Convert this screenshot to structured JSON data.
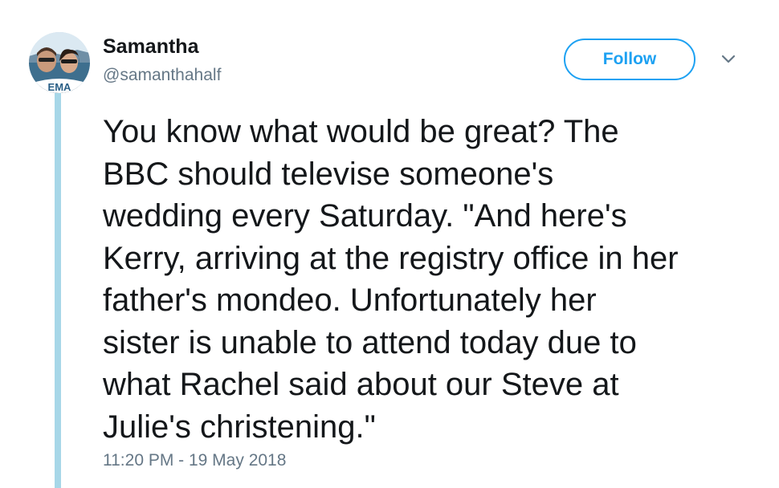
{
  "tweet": {
    "author": {
      "display_name": "Samantha",
      "handle": "@samanthahalf",
      "avatar_caption": "EMA"
    },
    "follow_label": "Follow",
    "menu_icon": "chevron-down-icon",
    "text": "You know what would be great? The\nBBC should televise someone's\nwedding every Saturday. \"And here's\nKerry, arriving at the registry office in her\nfather's mondeo. Unfortunately her\nsister is unable to attend today due to\nwhat Rachel said about our Steve at\nJulie's christening.\"",
    "timestamp": "11:20 PM - 19 May 2018"
  },
  "colors": {
    "accent": "#1da1f2",
    "thread_line": "#a7d7e8",
    "text_primary": "#14171a",
    "text_secondary": "#657786"
  }
}
